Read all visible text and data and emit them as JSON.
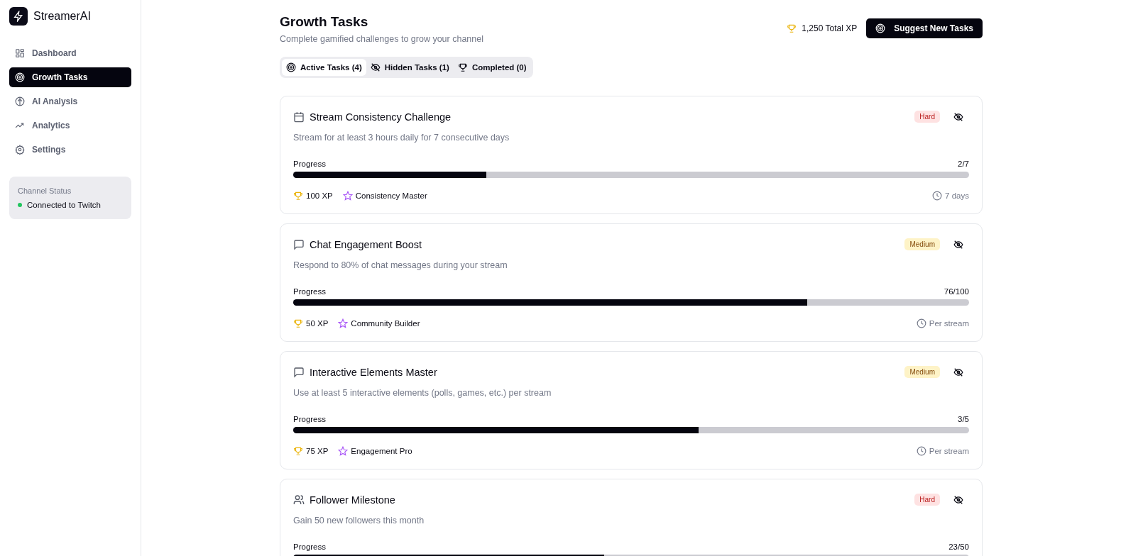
{
  "sidebar": {
    "brand": "StreamerAI",
    "items": [
      {
        "label": "Dashboard",
        "selected": false
      },
      {
        "label": "Growth Tasks",
        "selected": true
      },
      {
        "label": "AI Analysis",
        "selected": false
      },
      {
        "label": "Analytics",
        "selected": false
      },
      {
        "label": "Settings",
        "selected": false
      }
    ],
    "status": {
      "title": "Channel Status",
      "text": "Connected to Twitch",
      "color": "#22c55e"
    }
  },
  "header": {
    "title": "Growth Tasks",
    "subtitle": "Complete gamified challenges to grow your channel",
    "total_xp": "1,250 Total XP",
    "button": "Suggest New Tasks"
  },
  "tabs": [
    {
      "label": "Active Tasks (4)",
      "selected": true
    },
    {
      "label": "Hidden Tasks (1)",
      "selected": false
    },
    {
      "label": "Completed (0)",
      "selected": false
    }
  ],
  "tasks": [
    {
      "title": "Stream Consistency Challenge",
      "difficulty": "Hard",
      "kind": "hard",
      "description": "Stream for at least 3 hours daily for 7 consecutive days",
      "progress_label": "Progress",
      "progress_text": "2/7",
      "level": 0.286,
      "xp": "100 XP",
      "badge": "Consistency Master",
      "duration": "7 days"
    },
    {
      "title": "Chat Engagement Boost",
      "difficulty": "Medium",
      "kind": "medium",
      "description": "Respond to 80% of chat messages during your stream",
      "progress_label": "Progress",
      "progress_text": "76/100",
      "level": 0.76,
      "xp": "50 XP",
      "badge": "Community Builder",
      "duration": "Per stream"
    },
    {
      "title": "Interactive Elements Master",
      "difficulty": "Medium",
      "kind": "medium",
      "description": "Use at least 5 interactive elements (polls, games, etc.) per stream",
      "progress_label": "Progress",
      "progress_text": "3/5",
      "level": 0.6,
      "xp": "75 XP",
      "badge": "Engagement Pro",
      "duration": "Per stream"
    },
    {
      "title": "Follower Milestone",
      "difficulty": "Hard",
      "kind": "hard",
      "description": "Gain 50 new followers this month",
      "progress_label": "Progress",
      "progress_text": "23/50",
      "level": 0.46
    }
  ]
}
